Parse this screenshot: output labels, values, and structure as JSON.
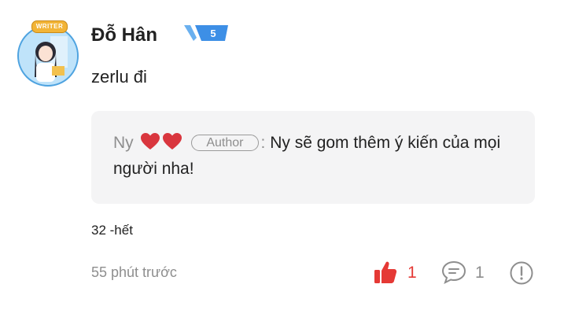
{
  "comment": {
    "author": {
      "name": "Đỗ Hân",
      "avatar_badge": "WRITER",
      "level": "5"
    },
    "text": "zerlu đi",
    "reply": {
      "name": "Ny",
      "role_tag": "Author",
      "separator": ":",
      "text": "Ny sẽ gom thêm ý kiến của mọi người nha!"
    },
    "extra": "32 -hết",
    "timestamp": "55 phút trước",
    "likes": "1",
    "replies": "1"
  },
  "colors": {
    "like_active": "#e53935",
    "muted": "#8e8e8e",
    "reply_bg": "#f4f4f5",
    "level_badge": "#3d8fe6"
  },
  "icons": [
    "heart-icon",
    "thumbs-up-icon",
    "comment-bubble-icon",
    "report-icon"
  ]
}
